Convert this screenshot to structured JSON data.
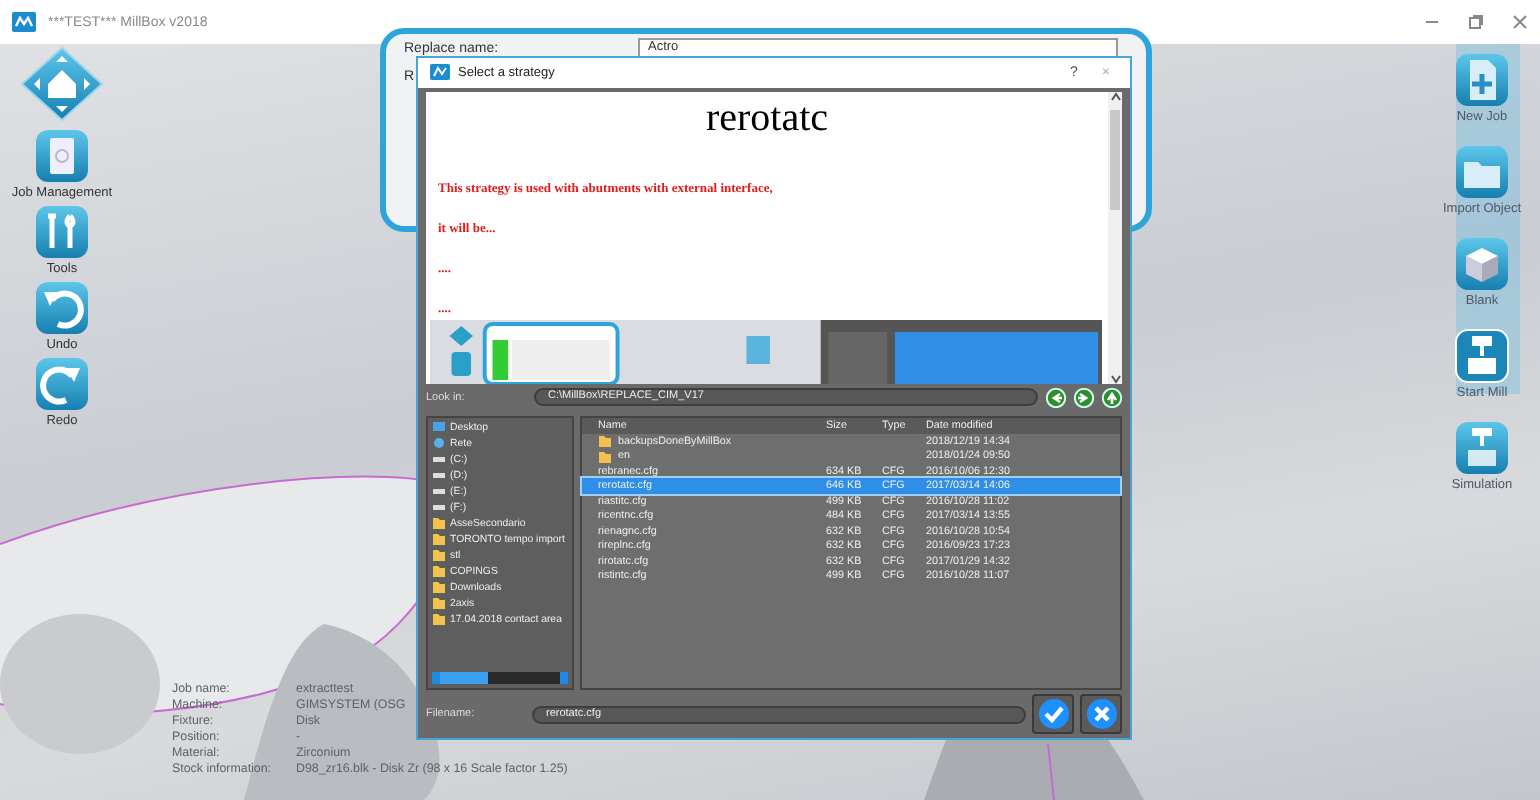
{
  "window": {
    "title": "***TEST*** MillBox v2018"
  },
  "left_toolbar": [
    {
      "kind": "home"
    },
    {
      "kind": "job",
      "label": "Job Management"
    },
    {
      "kind": "tools",
      "label": "Tools"
    },
    {
      "kind": "undo",
      "label": "Undo"
    },
    {
      "kind": "redo",
      "label": "Redo"
    }
  ],
  "right_toolbar": [
    {
      "kind": "new",
      "label": "New Job"
    },
    {
      "kind": "import",
      "label": "Import Object"
    },
    {
      "kind": "blank",
      "label": "Blank"
    },
    {
      "kind": "mill",
      "label": "Start Mill"
    },
    {
      "kind": "sim",
      "label": "Simulation"
    }
  ],
  "background_panel": {
    "labels": [
      "Replace name:",
      "R"
    ],
    "field_value": "Actro"
  },
  "job_info": [
    {
      "label": "Job name:",
      "value": "extracttest"
    },
    {
      "label": "Machine:",
      "value": "GIMSYSTEM (OSG"
    },
    {
      "label": "Fixture:",
      "value": "Disk"
    },
    {
      "label": "Position:",
      "value": "-"
    },
    {
      "label": "Material:",
      "value": "Zirconium"
    },
    {
      "label": "Stock information:",
      "value": "D98_zr16.blk - Disk Zr (98 x 16 Scale factor 1.25)"
    }
  ],
  "dialog": {
    "title": "Select a strategy",
    "help": "?",
    "close": "×",
    "preview": {
      "heading": "rerotatc",
      "lines": [
        "This strategy is used with abutments with external interface,",
        "it will be...",
        "....",
        "...."
      ]
    },
    "look_in": {
      "label": "Look in:",
      "path": "C:\\MillBox\\REPLACE_CIM_V17"
    },
    "tree": [
      {
        "kind": "desktop",
        "label": "Desktop"
      },
      {
        "kind": "network",
        "label": "Rete"
      },
      {
        "kind": "drive",
        "label": "(C:)"
      },
      {
        "kind": "drive",
        "label": "(D:)"
      },
      {
        "kind": "drive",
        "label": "(E:)"
      },
      {
        "kind": "drive",
        "label": "(F:)"
      },
      {
        "kind": "folder",
        "label": "AsseSecondario"
      },
      {
        "kind": "folder",
        "label": "TORONTO tempo import"
      },
      {
        "kind": "folder",
        "label": "stl"
      },
      {
        "kind": "folder",
        "label": "COPINGS"
      },
      {
        "kind": "folder",
        "label": "Downloads"
      },
      {
        "kind": "folder",
        "label": "2axis"
      },
      {
        "kind": "folder",
        "label": "17.04.2018 contact area"
      }
    ],
    "columns": [
      "Name",
      "Size",
      "Type",
      "Date modified"
    ],
    "files": [
      {
        "kind": "folder",
        "selected": false,
        "cells": [
          "backupsDoneByMillBox",
          "",
          "",
          "2018/12/19 14:34"
        ]
      },
      {
        "kind": "folder",
        "selected": false,
        "cells": [
          "en",
          "",
          "",
          "2018/01/24 09:50"
        ]
      },
      {
        "kind": "file",
        "selected": false,
        "cells": [
          "rebranec.cfg",
          "634 KB",
          "CFG",
          "2016/10/06 12:30"
        ]
      },
      {
        "kind": "file",
        "selected": true,
        "cells": [
          "rerotatc.cfg",
          "646 KB",
          "CFG",
          "2017/03/14 14:06"
        ]
      },
      {
        "kind": "file",
        "selected": false,
        "cells": [
          "riastitc.cfg",
          "499 KB",
          "CFG",
          "2016/10/28 11:02"
        ]
      },
      {
        "kind": "file",
        "selected": false,
        "cells": [
          "ricentnc.cfg",
          "484 KB",
          "CFG",
          "2017/03/14 13:55"
        ]
      },
      {
        "kind": "file",
        "selected": false,
        "cells": [
          "rienagnc.cfg",
          "632 KB",
          "CFG",
          "2016/10/28 10:54"
        ]
      },
      {
        "kind": "file",
        "selected": false,
        "cells": [
          "rireplnc.cfg",
          "632 KB",
          "CFG",
          "2016/09/23 17:23"
        ]
      },
      {
        "kind": "file",
        "selected": false,
        "cells": [
          "rirotatc.cfg",
          "632 KB",
          "CFG",
          "2017/01/29 14:32"
        ]
      },
      {
        "kind": "file",
        "selected": false,
        "cells": [
          "ristintc.cfg",
          "499 KB",
          "CFG",
          "2016/10/28 11:07"
        ]
      }
    ],
    "filename": {
      "label": "Filename:",
      "value": "rerotatc.cfg"
    }
  }
}
